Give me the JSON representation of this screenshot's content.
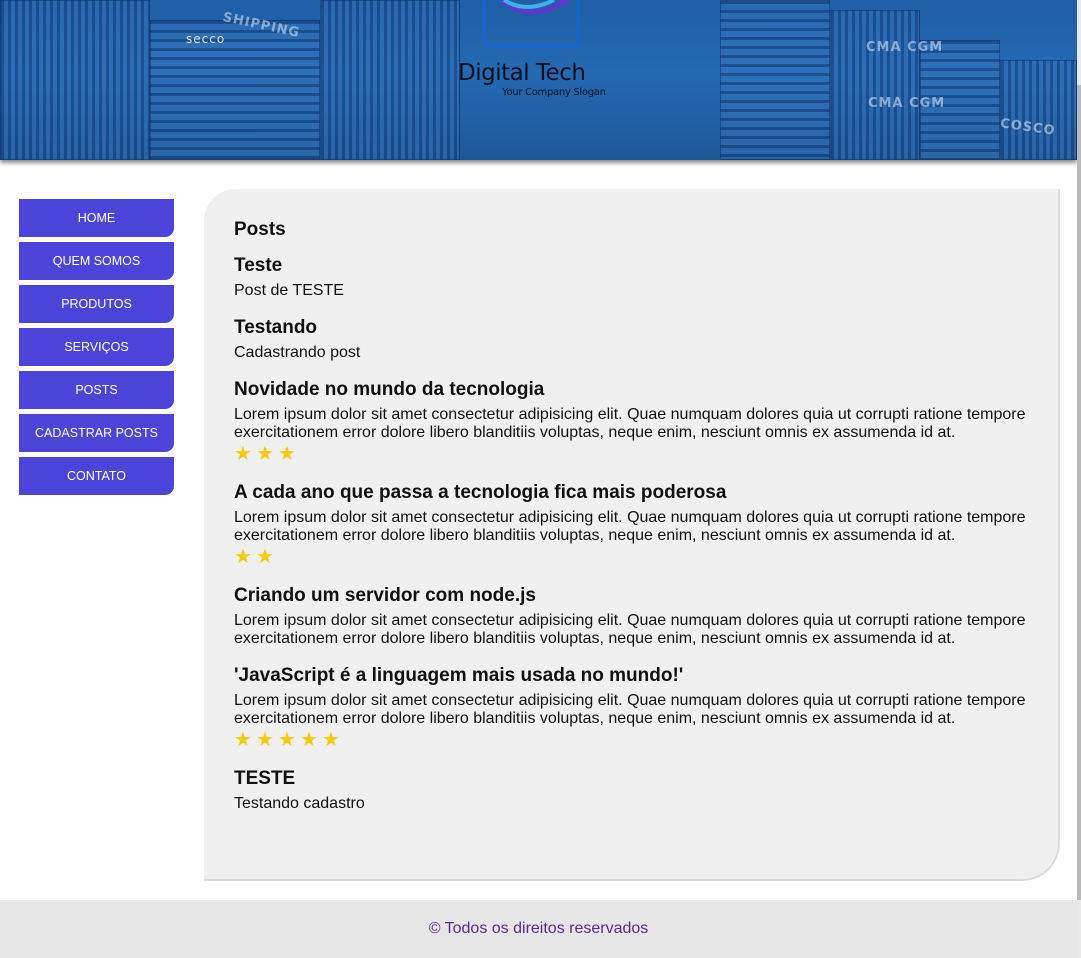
{
  "header": {
    "logo_title": "Digital Tech",
    "logo_slogan": "Your Company Slogan",
    "banner_texts": [
      "SHIPPING",
      "secco",
      "CMA CGM",
      "CMA CGM",
      "COSCO"
    ]
  },
  "nav": {
    "items": [
      {
        "label": "HOME"
      },
      {
        "label": "QUEM SOMOS"
      },
      {
        "label": "PRODUTOS"
      },
      {
        "label": "SERVIÇOS"
      },
      {
        "label": "POSTS"
      },
      {
        "label": "CADASTRAR POSTS"
      },
      {
        "label": "CONTATO"
      }
    ]
  },
  "main": {
    "title": "Posts",
    "posts": [
      {
        "title": "Teste",
        "body": "Post de TESTE",
        "rating": 0
      },
      {
        "title": "Testando",
        "body": "Cadastrando post",
        "rating": 0
      },
      {
        "title": "Novidade no mundo da tecnologia",
        "body": "Lorem ipsum dolor sit amet consectetur adipisicing elit. Quae numquam dolores quia ut corrupti ratione tempore exercitationem error dolore libero blanditiis voluptas, neque enim, nesciunt omnis ex assumenda id at.",
        "rating": 3
      },
      {
        "title": "A cada ano que passa a tecnologia fica mais poderosa",
        "body": "Lorem ipsum dolor sit amet consectetur adipisicing elit. Quae numquam dolores quia ut corrupti ratione tempore exercitationem error dolore libero blanditiis voluptas, neque enim, nesciunt omnis ex assumenda id at.",
        "rating": 2
      },
      {
        "title": "Criando um servidor com node.js",
        "body": "Lorem ipsum dolor sit amet consectetur adipisicing elit. Quae numquam dolores quia ut corrupti ratione tempore exercitationem error dolore libero blanditiis voluptas, neque enim, nesciunt omnis ex assumenda id at.",
        "rating": 0
      },
      {
        "title": "'JavaScript é a linguagem mais usada no mundo!'",
        "body": "Lorem ipsum dolor sit amet consectetur adipisicing elit. Quae numquam dolores quia ut corrupti ratione tempore exercitationem error dolore libero blanditiis voluptas, neque enim, nesciunt omnis ex assumenda id at.",
        "rating": 5
      },
      {
        "title": "TESTE",
        "body": "Testando cadastro",
        "rating": 0
      }
    ]
  },
  "footer": {
    "text": "© Todos os direitos reservados"
  },
  "colors": {
    "nav_bg": "#4b44d8",
    "star": "#f6c90e",
    "footer_text": "#5a2a8a",
    "panel_bg": "#f0f0f0"
  },
  "icons": {
    "star": "star-icon"
  }
}
